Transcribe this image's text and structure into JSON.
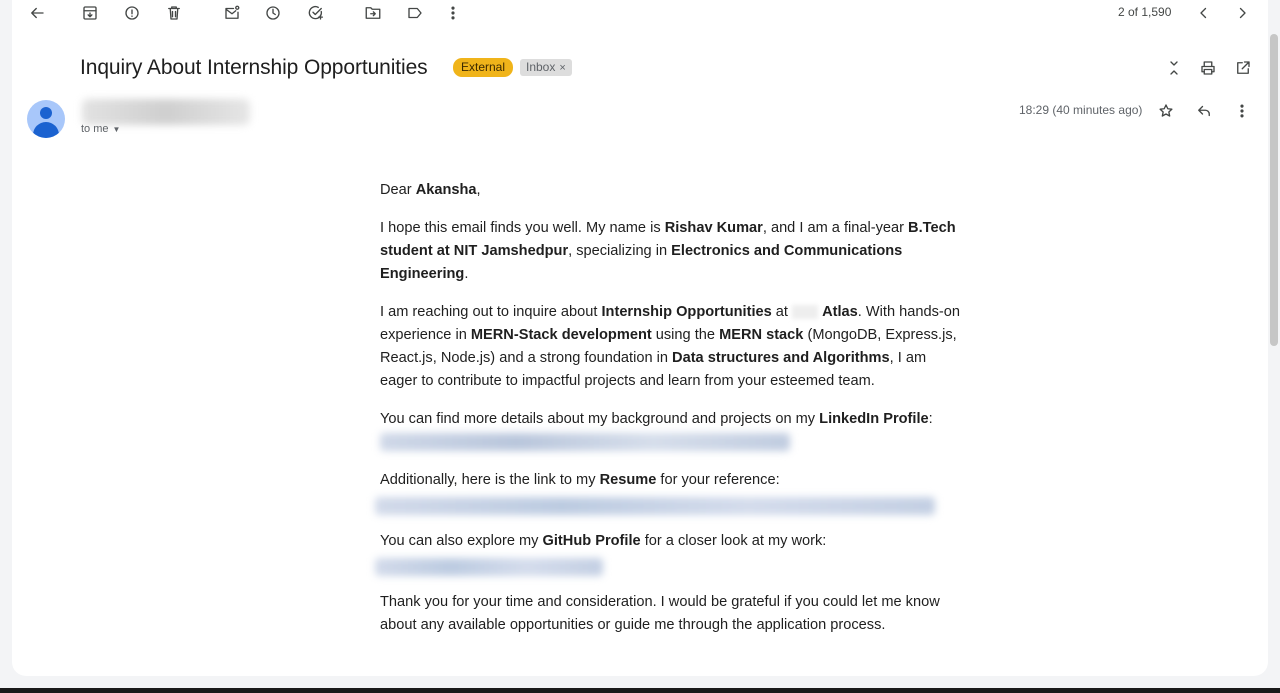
{
  "toolbar": {
    "counter": "2 of 1,590"
  },
  "email": {
    "subject": "Inquiry About Internship Opportunities",
    "labels": {
      "external": "External",
      "inbox": "Inbox",
      "inbox_remove": "×"
    },
    "recipient": "to me",
    "time": "18:29 (40 minutes ago)"
  },
  "body": {
    "greeting": {
      "t1": "Dear ",
      "name": "Akansha",
      "t2": ","
    },
    "para1": {
      "t1": "I hope this email finds you well. My name is ",
      "name": "Rishav Kumar",
      "t2": ", and I am a final-year ",
      "degree": "B.Tech student at NIT Jamshedpur",
      "t3": ", specializing in ",
      "field": "Electronics and Communications Engineering",
      "t4": "."
    },
    "para2": {
      "t1": "I am reaching out to inquire about ",
      "topic": "Internship Opportunities",
      "t2": " at ",
      "company": "Atlas",
      "t3": ". With hands-on experience in ",
      "skill1": "MERN-Stack development",
      "t4": " using the ",
      "skill2": "MERN stack",
      "t5": " (MongoDB, Express.js, React.js, Node.js) and a strong foundation in ",
      "skill3": "Data structures and Algorithms",
      "t6": ", I am eager to contribute to impactful projects and learn from your esteemed team."
    },
    "para3": {
      "t1": "You can find more details about my background and projects on my ",
      "link_label": "LinkedIn Profile",
      "t2": ":"
    },
    "para4": {
      "t1": "Additionally, here is the link to my ",
      "link_label": "Resume",
      "t2": " for your reference:"
    },
    "para5": {
      "t1": "You can also explore my ",
      "link_label": "GitHub Profile",
      "t2": " for a closer look at my work:"
    },
    "para6": {
      "t1": "Thank you for your time and consideration. I would be grateful if you could let me know about any available opportunities or guide me through the application process."
    }
  },
  "colors": {
    "external_badge": "#f0b41a",
    "inbox_badge": "#dddddd",
    "avatar_bg": "#a8c7fa",
    "avatar_fg": "#1b62d0"
  }
}
